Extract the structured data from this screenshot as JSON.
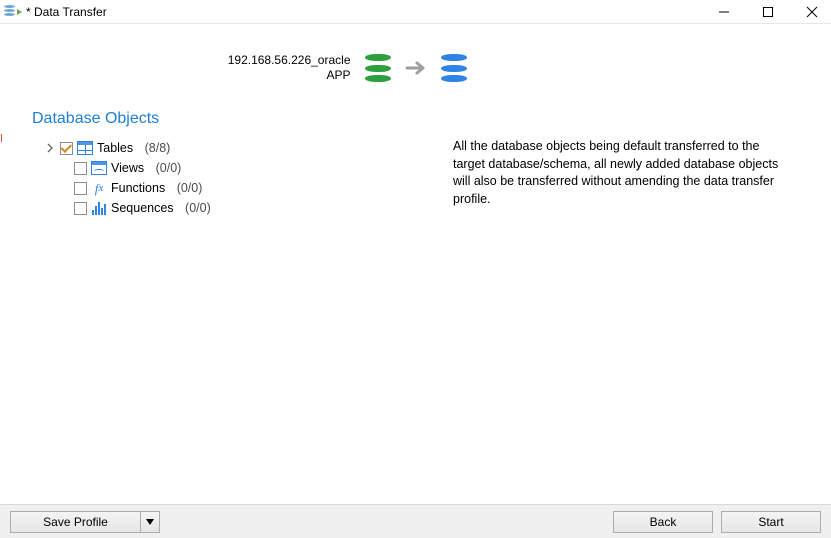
{
  "window": {
    "title": "* Data Transfer"
  },
  "connection": {
    "source_line1": "192.168.56.226_oracle",
    "source_line2": "APP",
    "target_label": ""
  },
  "section": {
    "heading": "Database Objects"
  },
  "tree": {
    "tables": {
      "label": "Tables",
      "count": "(8/8)",
      "checked": true,
      "expandable": true
    },
    "views": {
      "label": "Views",
      "count": "(0/0)",
      "checked": false
    },
    "functions": {
      "label": "Functions",
      "count": "(0/0)",
      "checked": false
    },
    "sequences": {
      "label": "Sequences",
      "count": "(0/0)",
      "checked": false
    }
  },
  "description": {
    "text": "All the database objects being default transferred to the target database/schema, all newly added database objects will also be transferred without amending the data transfer profile."
  },
  "footer": {
    "save_profile": "Save Profile",
    "back": "Back",
    "start": "Start"
  }
}
